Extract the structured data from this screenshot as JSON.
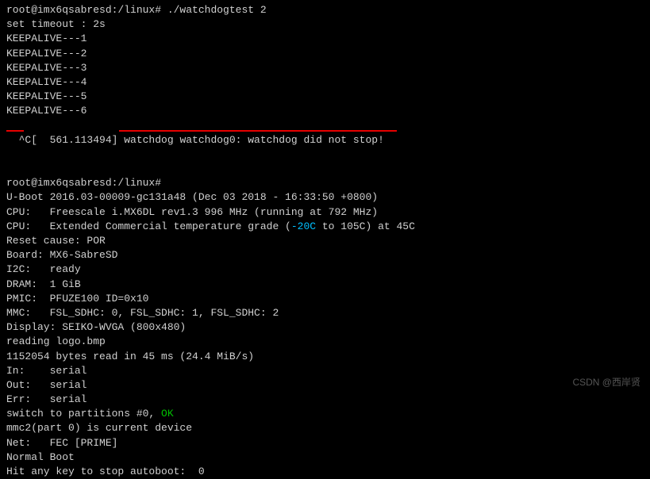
{
  "lines": {
    "prompt1": "root@imx6qsabresd:/linux# ./watchdogtest 2",
    "timeout": "set timeout : 2s",
    "ka1": "KEEPALIVE---1",
    "ka2": "KEEPALIVE---2",
    "ka3": "KEEPALIVE---3",
    "ka4": "KEEPALIVE---4",
    "ka5": "KEEPALIVE---5",
    "ka6": "KEEPALIVE---6",
    "ctrlc": "^C[  561.113494] watchdog watchdog0: watchdog did not stop!",
    "blank": "",
    "prompt2": "root@imx6qsabresd:/linux#",
    "uboot": "U-Boot 2016.03-00009-gc131a48 (Dec 03 2018 - 16:33:50 +0800)",
    "cpu1": "CPU:   Freescale i.MX6DL rev1.3 996 MHz (running at 792 MHz)",
    "cpu2_pre": "CPU:   Extended Commercial temperature grade (",
    "cpu2_cyan": "-20C",
    "cpu2_post": " to 105C) at 45C",
    "reset": "Reset cause: POR",
    "board": "Board: MX6-SabreSD",
    "i2c": "I2C:   ready",
    "dram": "DRAM:  1 GiB",
    "pmic": "PMIC:  PFUZE100 ID=0x10",
    "mmc": "MMC:   FSL_SDHC: 0, FSL_SDHC: 1, FSL_SDHC: 2",
    "display": "Display: SEIKO-WVGA (800x480)",
    "reading": "reading logo.bmp",
    "bytes": "1152054 bytes read in 45 ms (24.4 MiB/s)",
    "in": "In:    serial",
    "out": "Out:   serial",
    "err": "Err:   serial",
    "switch_pre": "switch to partitions #0, ",
    "switch_ok": "OK",
    "mmc2": "mmc2(part 0) is current device",
    "net": "Net:   FEC [PRIME]",
    "normal": "Normal Boot",
    "autoboot": "Hit any key to stop autoboot:  0"
  },
  "watermark": "CSDN @西岸贤"
}
